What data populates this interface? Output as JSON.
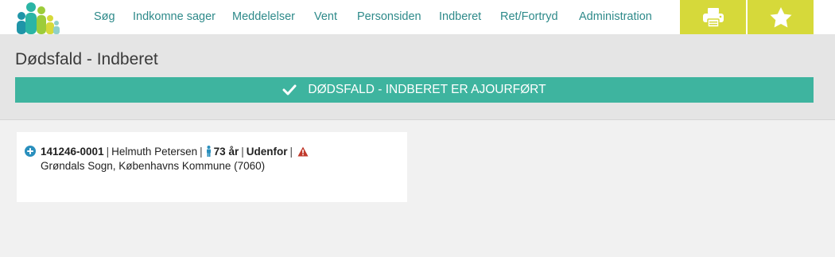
{
  "nav": {
    "items": [
      {
        "label": "Søg",
        "id": "sog"
      },
      {
        "label": "Indkomne sager",
        "id": "indkomne-sager"
      },
      {
        "label": "Meddelelser",
        "id": "meddelelser"
      },
      {
        "label": "Vent",
        "id": "vent"
      },
      {
        "label": "Personsiden",
        "id": "personsiden"
      },
      {
        "label": "Indberet",
        "id": "indberet"
      },
      {
        "label": "Ret/Fortryd",
        "id": "ret-fortryd"
      },
      {
        "label": "Administration",
        "id": "administration"
      }
    ],
    "tools": [
      {
        "icon": "printer-icon"
      },
      {
        "icon": "star-icon"
      }
    ]
  },
  "page": {
    "title": "Dødsfald - Indberet"
  },
  "status": {
    "text": "DØDSFALD - INDBERET ER AJOURFØRT",
    "icon": "check-icon"
  },
  "person": {
    "cpr": "141246-0001",
    "name": "Helmuth Petersen",
    "age": "73 år",
    "status": "Udenfor",
    "location": "Grøndals Sogn, Københavns Kommune (7060)"
  },
  "colors": {
    "accent": "#3eb49f",
    "nav_text": "#2e8a8a",
    "tool_button": "#d6d93a",
    "header_band": "#e5e5e5",
    "warning": "#c0392b",
    "info_icon": "#2a8fbd"
  }
}
